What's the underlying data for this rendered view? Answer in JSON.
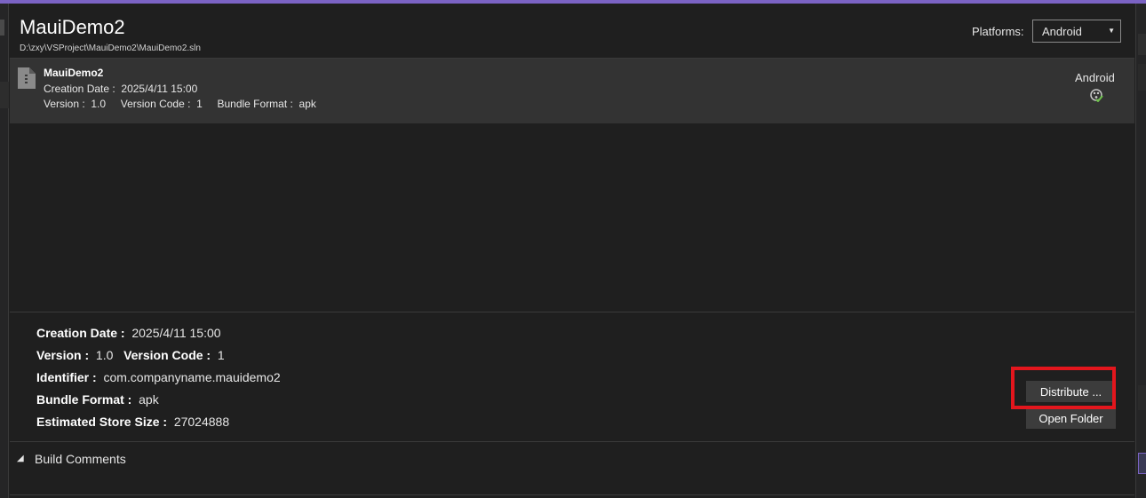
{
  "header": {
    "title": "MauiDemo2",
    "path": "D:\\zxy\\VSProject\\MauiDemo2\\MauiDemo2.sln",
    "platforms_label": "Platforms:",
    "platform_selected": "Android"
  },
  "archives": [
    {
      "name": "MauiDemo2",
      "creation_date_label": "Creation Date :",
      "creation_date": "2025/4/11 15:00",
      "version_label": "Version :",
      "version": "1.0",
      "version_code_label": "Version Code :",
      "version_code": "1",
      "bundle_format_label": "Bundle Format :",
      "bundle_format": "apk",
      "platform": "Android",
      "platform_icon": "android-icon"
    }
  ],
  "details": {
    "creation_date_label": "Creation Date :",
    "creation_date": "2025/4/11 15:00",
    "version_label": "Version :",
    "version": "1.0",
    "version_code_label": "Version Code :",
    "version_code": "1",
    "identifier_label": "Identifier :",
    "identifier": "com.companyname.mauidemo2",
    "bundle_format_label": "Bundle Format :",
    "bundle_format": "apk",
    "store_size_label": "Estimated Store Size :",
    "store_size": "27024888"
  },
  "actions": {
    "distribute_label": "Distribute ...",
    "open_folder_label": "Open Folder"
  },
  "comments": {
    "label": "Build Comments",
    "toggle": "◢"
  },
  "colors": {
    "accent": "#7b63c4",
    "highlight": "#e3161d",
    "selected_row": "#333333",
    "background": "#1f1f1f"
  }
}
